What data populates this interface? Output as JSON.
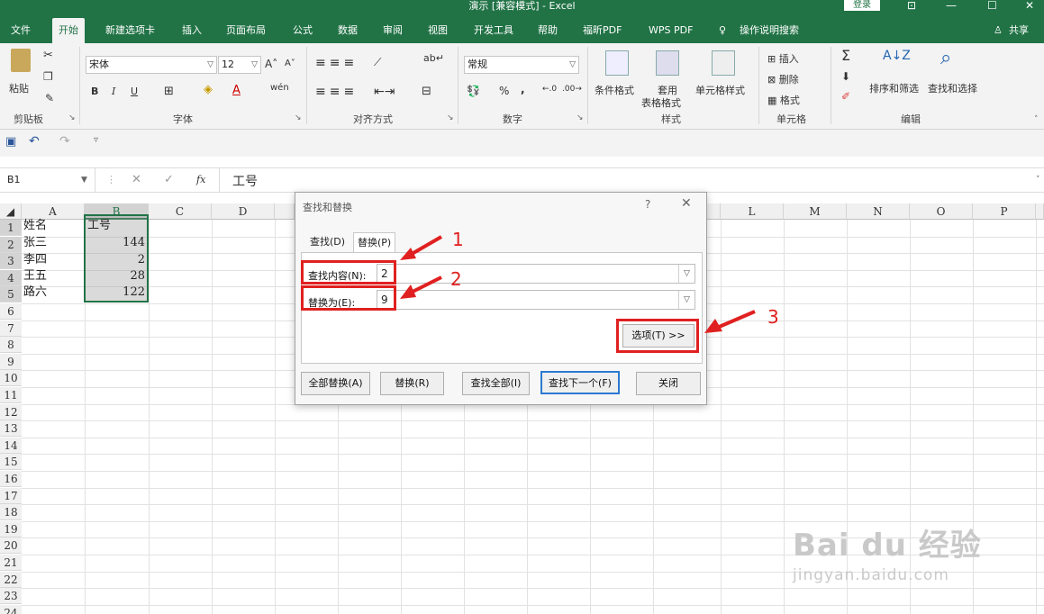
{
  "window": {
    "title": "演示 [兼容模式] - Excel",
    "login_label": "登录",
    "controls": [
      "⊡",
      "—",
      "☐",
      "✕"
    ]
  },
  "menubar": {
    "items": [
      "文件",
      "开始",
      "新建选项卡",
      "插入",
      "页面布局",
      "公式",
      "数据",
      "审阅",
      "视图",
      "开发工具",
      "帮助",
      "福昕PDF",
      "WPS PDF"
    ],
    "tell_me": "操作说明搜索",
    "share": "共享"
  },
  "ribbon": {
    "clipboard": {
      "paste": "粘贴",
      "label": "剪贴板"
    },
    "font": {
      "name": "宋体",
      "size": "12",
      "label": "字体",
      "bold": "B",
      "italic": "I",
      "underline": "U"
    },
    "alignment": {
      "label": "对齐方式"
    },
    "number": {
      "format": "常规",
      "label": "数字",
      "percent": "%",
      "comma": ","
    },
    "styles": {
      "conditional": "条件格式",
      "table_format_1": "套用",
      "table_format_2": "表格格式",
      "cell_styles": "单元格样式",
      "label": "样式"
    },
    "cells": {
      "insert": "插入",
      "delete": "删除",
      "format": "格式",
      "label": "单元格"
    },
    "editing": {
      "sort_filter": "排序和筛选",
      "find_select": "查找和选择",
      "label": "编辑"
    }
  },
  "formula_bar": {
    "name_box": "B1",
    "content": "工号",
    "fx": "fx"
  },
  "sheet": {
    "columns": [
      "A",
      "B",
      "C",
      "D",
      "E",
      "F",
      "G",
      "H",
      "I",
      "J",
      "K",
      "L",
      "M",
      "N",
      "O",
      "P"
    ],
    "rows": [
      "1",
      "2",
      "3",
      "4",
      "5",
      "6",
      "7",
      "8",
      "9",
      "10",
      "11",
      "12",
      "13",
      "14",
      "15",
      "16",
      "17",
      "18",
      "19",
      "20",
      "21",
      "22",
      "23",
      "24"
    ],
    "data": [
      {
        "a": "姓名",
        "b": "工号"
      },
      {
        "a": "张三",
        "b": "144"
      },
      {
        "a": "李四",
        "b": "2"
      },
      {
        "a": "王五",
        "b": "28"
      },
      {
        "a": "路六",
        "b": "122"
      }
    ]
  },
  "dialog": {
    "title": "查找和替换",
    "help": "?",
    "close_x": "✕",
    "tabs": [
      "查找(D)",
      "替换(P)"
    ],
    "find_label": "查找内容(N):",
    "find_value": "2",
    "replace_label": "替换为(E):",
    "replace_value": "9",
    "options_button": "选项(T) >>",
    "buttons": [
      "全部替换(A)",
      "替换(R)",
      "查找全部(I)",
      "查找下一个(F)",
      "关闭"
    ]
  },
  "annotations": [
    "1",
    "2",
    "3"
  ],
  "watermark": {
    "brand": "Bai du 经验",
    "url": "jingyan.baidu.com"
  }
}
